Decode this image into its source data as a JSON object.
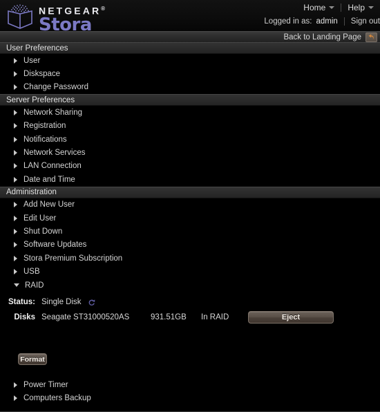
{
  "brand": {
    "company": "NETGEAR",
    "trademark": "®",
    "product": "Stora",
    "logo_icon": "cube-logo-icon"
  },
  "topnav": {
    "items": [
      {
        "label": "Home",
        "icon": "chevron-down-icon"
      },
      {
        "label": "Help",
        "icon": "chevron-down-icon"
      }
    ]
  },
  "session": {
    "logged_in_label": "Logged in as:",
    "username": "admin",
    "sign_out": "Sign out"
  },
  "backbar": {
    "label": "Back to Landing Page",
    "icon": "back-arrow-icon"
  },
  "sections": [
    {
      "title": "User Preferences",
      "items": [
        {
          "label": "User",
          "expanded": false
        },
        {
          "label": "Diskspace",
          "expanded": false
        },
        {
          "label": "Change Password",
          "expanded": false
        }
      ]
    },
    {
      "title": "Server Preferences",
      "items": [
        {
          "label": "Network Sharing",
          "expanded": false
        },
        {
          "label": "Registration",
          "expanded": false
        },
        {
          "label": "Notifications",
          "expanded": false
        },
        {
          "label": "Network Services",
          "expanded": false
        },
        {
          "label": "LAN Connection",
          "expanded": false
        },
        {
          "label": "Date and Time",
          "expanded": false
        }
      ]
    },
    {
      "title": "Administration",
      "items": [
        {
          "label": "Add New User",
          "expanded": false
        },
        {
          "label": "Edit User",
          "expanded": false
        },
        {
          "label": "Shut Down",
          "expanded": false
        },
        {
          "label": "Software Updates",
          "expanded": false
        },
        {
          "label": "Stora Premium Subscription",
          "expanded": false
        },
        {
          "label": "USB",
          "expanded": false
        },
        {
          "label": "RAID",
          "expanded": true
        }
      ]
    }
  ],
  "raid": {
    "status_label": "Status:",
    "status_value": "Single Disk",
    "refresh_icon": "refresh-icon",
    "disks_label": "Disks",
    "disk": {
      "name": "Seagate ST31000520AS",
      "size": "931.51GB",
      "state": "In RAID",
      "eject_button": "Eject"
    },
    "format_button": "Format"
  },
  "bottom_items": [
    {
      "label": "Power Timer",
      "expanded": false
    },
    {
      "label": "Computers Backup",
      "expanded": false
    }
  ],
  "colors": {
    "background": "#000000",
    "brand_accent": "#7b79c4",
    "section_header": "#2b2b2b",
    "button": "#5b5149",
    "text": "#d8d8d8"
  }
}
